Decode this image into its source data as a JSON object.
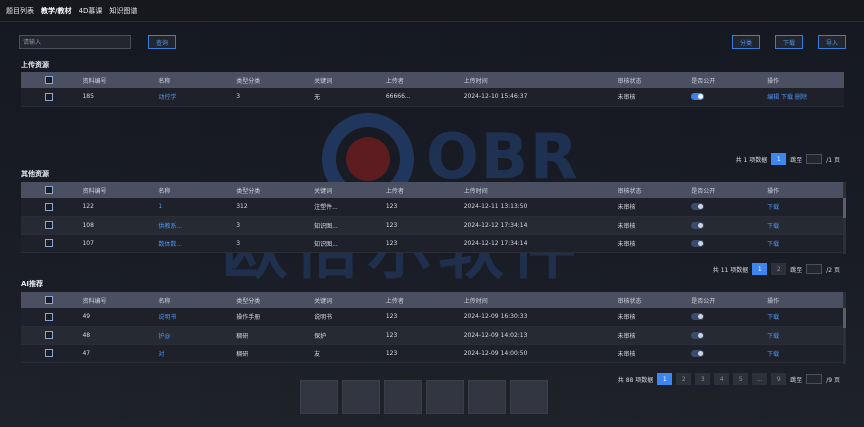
{
  "tabs": [
    "题目列表",
    "教学/教材",
    "4D慕课",
    "知识图谱"
  ],
  "search": {
    "placeholder": "请输入",
    "query_label": "查询"
  },
  "toolbar": {
    "share_label": "分类",
    "download_label": "下载",
    "import_label": "导入"
  },
  "headers": [
    "资料编号",
    "名称",
    "类型分类",
    "关键词",
    "上传者",
    "上传时间",
    "审核状态",
    "是否公开",
    "操作"
  ],
  "upload": {
    "title": "上传资源",
    "rows": [
      {
        "id": "185",
        "name": "动控学",
        "type": "3",
        "keyword": "无",
        "uploader": "66666...",
        "time": "2024-12-10  15:46:37",
        "status": "未审核",
        "public": true,
        "ops": [
          "编辑",
          "下载",
          "删除"
        ]
      }
    ],
    "pager": {
      "total": "共 1 项数据",
      "pages": [
        "1"
      ],
      "goto": "跳至",
      "suffix": "/1 页"
    }
  },
  "other": {
    "title": "其他资源",
    "rows": [
      {
        "id": "122",
        "name": "1",
        "type": "312",
        "keyword": "注塑件...",
        "uploader": "123",
        "time": "2024-12-11  13:13:50",
        "status": "未审核",
        "public": false,
        "ops": [
          "下载"
        ]
      },
      {
        "id": "108",
        "name": "供教系...",
        "type": "3",
        "keyword": "知识图...",
        "uploader": "123",
        "time": "2024-12-12  17:34:14",
        "status": "未审核",
        "public": false,
        "ops": [
          "下载"
        ]
      },
      {
        "id": "107",
        "name": "数体数...",
        "type": "3",
        "keyword": "知识图...",
        "uploader": "123",
        "time": "2024-12-12  17:34:14",
        "status": "未审核",
        "public": false,
        "ops": [
          "下载"
        ]
      }
    ],
    "pager": {
      "total": "共 11 项数据",
      "pages": [
        "1",
        "2"
      ],
      "goto": "跳至",
      "suffix": "/2 页"
    }
  },
  "ai": {
    "title": "AI推荐",
    "rows": [
      {
        "id": "49",
        "name": "说明书",
        "type": "操作手册",
        "keyword": "说明书",
        "uploader": "123",
        "time": "2024-12-09  16:30:33",
        "status": "未审核",
        "public": false,
        "ops": [
          "下载"
        ]
      },
      {
        "id": "48",
        "name": "护@",
        "type": "稠研",
        "keyword": "保护",
        "uploader": "123",
        "time": "2024-12-09  14:02:13",
        "status": "未审核",
        "public": false,
        "ops": [
          "下载"
        ]
      },
      {
        "id": "47",
        "name": "对",
        "type": "稠研",
        "keyword": "友",
        "uploader": "123",
        "time": "2024-12-09  14:00:50",
        "status": "未审核",
        "public": false,
        "ops": [
          "下载"
        ]
      }
    ],
    "pager": {
      "total": "共 88 项数据",
      "pages": [
        "1",
        "2",
        "3",
        "4",
        "5",
        "...",
        "9"
      ],
      "goto": "跳至",
      "suffix": "/9 页"
    }
  },
  "watermark": {
    "en": "OBR",
    "cn": "欧倍尔软件"
  }
}
